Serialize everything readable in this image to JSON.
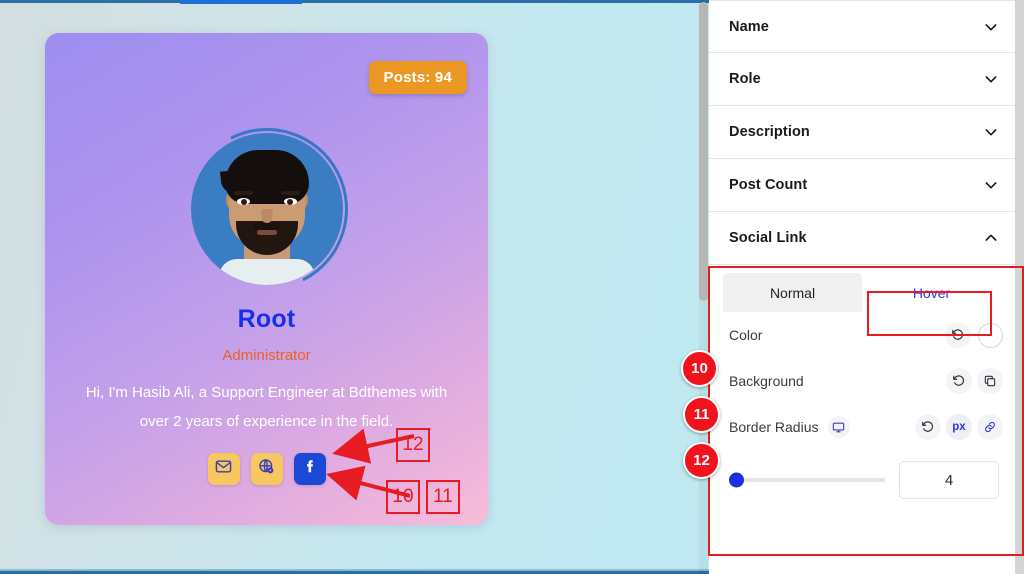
{
  "canvas": {
    "card": {
      "posts_badge": "Posts: 94",
      "name": "Root",
      "role": "Administrator",
      "bio": "Hi, I'm Hasib Ali, a Support Engineer at Bdthemes with over 2 years of experience in the field.",
      "socials": [
        {
          "name": "email-icon",
          "label": "Email",
          "style": "yellow"
        },
        {
          "name": "website-icon",
          "label": "Website",
          "style": "yellow"
        },
        {
          "name": "facebook-icon",
          "label": "Facebook",
          "style": "fb"
        }
      ]
    }
  },
  "panel": {
    "sections": [
      {
        "label": "Name",
        "icon": "chevron-down-icon",
        "expanded": false
      },
      {
        "label": "Role",
        "icon": "chevron-down-icon",
        "expanded": false
      },
      {
        "label": "Description",
        "icon": "chevron-down-icon",
        "expanded": false
      },
      {
        "label": "Post Count",
        "icon": "chevron-down-icon",
        "expanded": false
      },
      {
        "label": "Social Link",
        "icon": "chevron-up-icon",
        "expanded": true
      }
    ],
    "social_link": {
      "tabs": [
        {
          "label": "Normal",
          "active": false
        },
        {
          "label": "Hover",
          "active": true
        }
      ],
      "controls": [
        {
          "label": "Color",
          "reset": "reset-icon",
          "value_type": "color",
          "color": "#ffffff"
        },
        {
          "label": "Background",
          "reset": "reset-icon",
          "value_type": "layers"
        },
        {
          "label": "Border Radius",
          "device": "desktop-icon",
          "reset": "reset-icon",
          "unit": "px",
          "link": "link-icon"
        }
      ],
      "border_radius": {
        "value": "4",
        "slider_percent": 2
      }
    }
  },
  "annotations": {
    "panel_badges": [
      {
        "number": "10",
        "target": "Color"
      },
      {
        "number": "11",
        "target": "Background"
      },
      {
        "number": "12",
        "target": "Border Radius"
      }
    ],
    "canvas_badges": [
      {
        "number": "12"
      },
      {
        "number": "10"
      },
      {
        "number": "11"
      }
    ]
  },
  "colors": {
    "accent_blue": "#2b34e0",
    "annotation_red": "#e81b23",
    "badge_orange": "#eb9724",
    "name_blue": "#1330ea",
    "role_orange": "#e9622a",
    "facebook_blue": "#1b49d6",
    "social_yellow": "#f6c85f"
  }
}
